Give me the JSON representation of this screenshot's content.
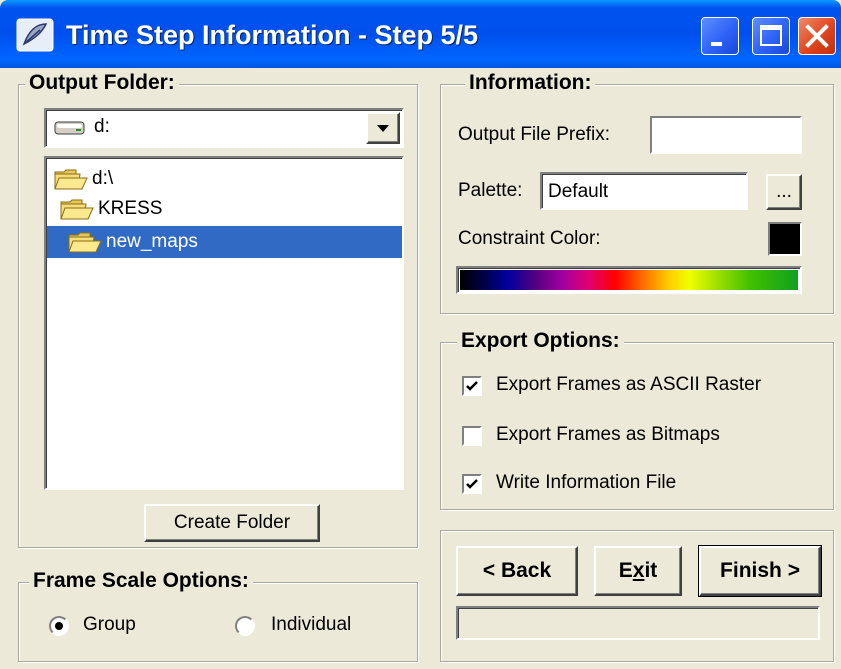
{
  "window": {
    "title": "Time Step Information - Step 5/5"
  },
  "output_folder": {
    "legend": "Output Folder:",
    "drive": "d:",
    "tree": [
      {
        "label": "d:\\",
        "selected": false
      },
      {
        "label": "KRESS",
        "selected": false
      },
      {
        "label": "new_maps",
        "selected": true
      }
    ],
    "create_folder_label": "Create Folder"
  },
  "frame_scale": {
    "legend": "Frame Scale Options:",
    "options": [
      {
        "label": "Group",
        "selected": true
      },
      {
        "label": "Individual",
        "selected": false
      }
    ]
  },
  "information": {
    "legend": "Information:",
    "prefix_label": "Output File Prefix:",
    "prefix_value": "",
    "palette_label": "Palette:",
    "palette_value": "Default",
    "browse_label": "...",
    "constraint_label": "Constraint Color:",
    "constraint_color": "#000000"
  },
  "export": {
    "legend": "Export Options:",
    "options": [
      {
        "label": "Export Frames as ASCII Raster",
        "checked": true
      },
      {
        "label": "Export Frames as Bitmaps",
        "checked": false
      },
      {
        "label": "Write Information File",
        "checked": true
      }
    ]
  },
  "nav": {
    "back_label": "< Back",
    "exit_prefix": "E",
    "exit_hotkey": "x",
    "exit_suffix": "it",
    "finish_label": "Finish >",
    "status_text": ""
  }
}
